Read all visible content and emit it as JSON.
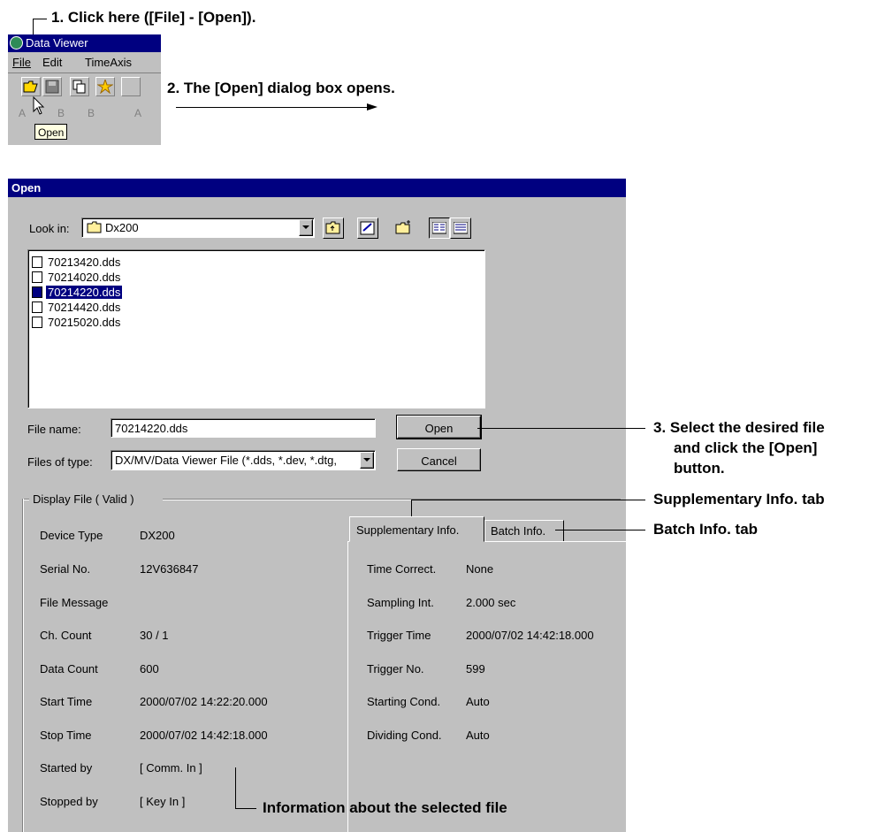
{
  "annotations": {
    "step1": "1. Click here ([File] - [Open]).",
    "step2": "2. The [Open] dialog box opens.",
    "step3_line1": "3. Select the desired file",
    "step3_line2": "and click the [Open]",
    "step3_line3": "button.",
    "supp_tab": "Supplementary Info. tab",
    "batch_tab": "Batch Info. tab",
    "info_selected": "Information about the selected file"
  },
  "mini_window": {
    "title": "Data Viewer",
    "menu": [
      "File",
      "Edit",
      "TimeAxis"
    ],
    "tooltip": "Open",
    "nav_buttons": [
      "A",
      "B",
      "B",
      "A"
    ]
  },
  "dialog": {
    "title": "Open",
    "look_in_label": "Look in:",
    "look_in_value": "Dx200",
    "files": [
      "70213420.dds",
      "70214020.dds",
      "70214220.dds",
      "70214420.dds",
      "70215020.dds"
    ],
    "selected_index": 2,
    "file_name_label": "File name:",
    "file_name_value": "70214220.dds",
    "files_of_type_label": "Files of type:",
    "files_of_type_value": "DX/MV/Data Viewer File (*.dds, *.dev, *.dtg,",
    "open_button": "Open",
    "cancel_button": "Cancel",
    "display_file_label": "Display File ( Valid )",
    "left_info": [
      {
        "label": "Device Type",
        "value": "DX200"
      },
      {
        "label": "Serial No.",
        "value": "12V636847"
      },
      {
        "label": "File Message",
        "value": ""
      },
      {
        "label": "Ch. Count",
        "value": "30 / 1"
      },
      {
        "label": "Data Count",
        "value": "600"
      },
      {
        "label": "Start Time",
        "value": "2000/07/02 14:22:20.000"
      },
      {
        "label": "Stop Time",
        "value": "2000/07/02 14:42:18.000"
      },
      {
        "label": "Started by",
        "value": "[ Comm. In ]"
      },
      {
        "label": "Stopped by",
        "value": "[ Key In ]"
      }
    ],
    "tabs": [
      "Supplementary Info.",
      "Batch Info."
    ],
    "right_info": [
      {
        "label": "Time Correct.",
        "value": "None"
      },
      {
        "label": "Sampling Int.",
        "value": "2.000 sec"
      },
      {
        "label": "Trigger Time",
        "value": "2000/07/02 14:42:18.000"
      },
      {
        "label": "Trigger No.",
        "value": "599"
      },
      {
        "label": "Starting Cond.",
        "value": "Auto"
      },
      {
        "label": "Dividing Cond.",
        "value": "Auto"
      }
    ]
  }
}
